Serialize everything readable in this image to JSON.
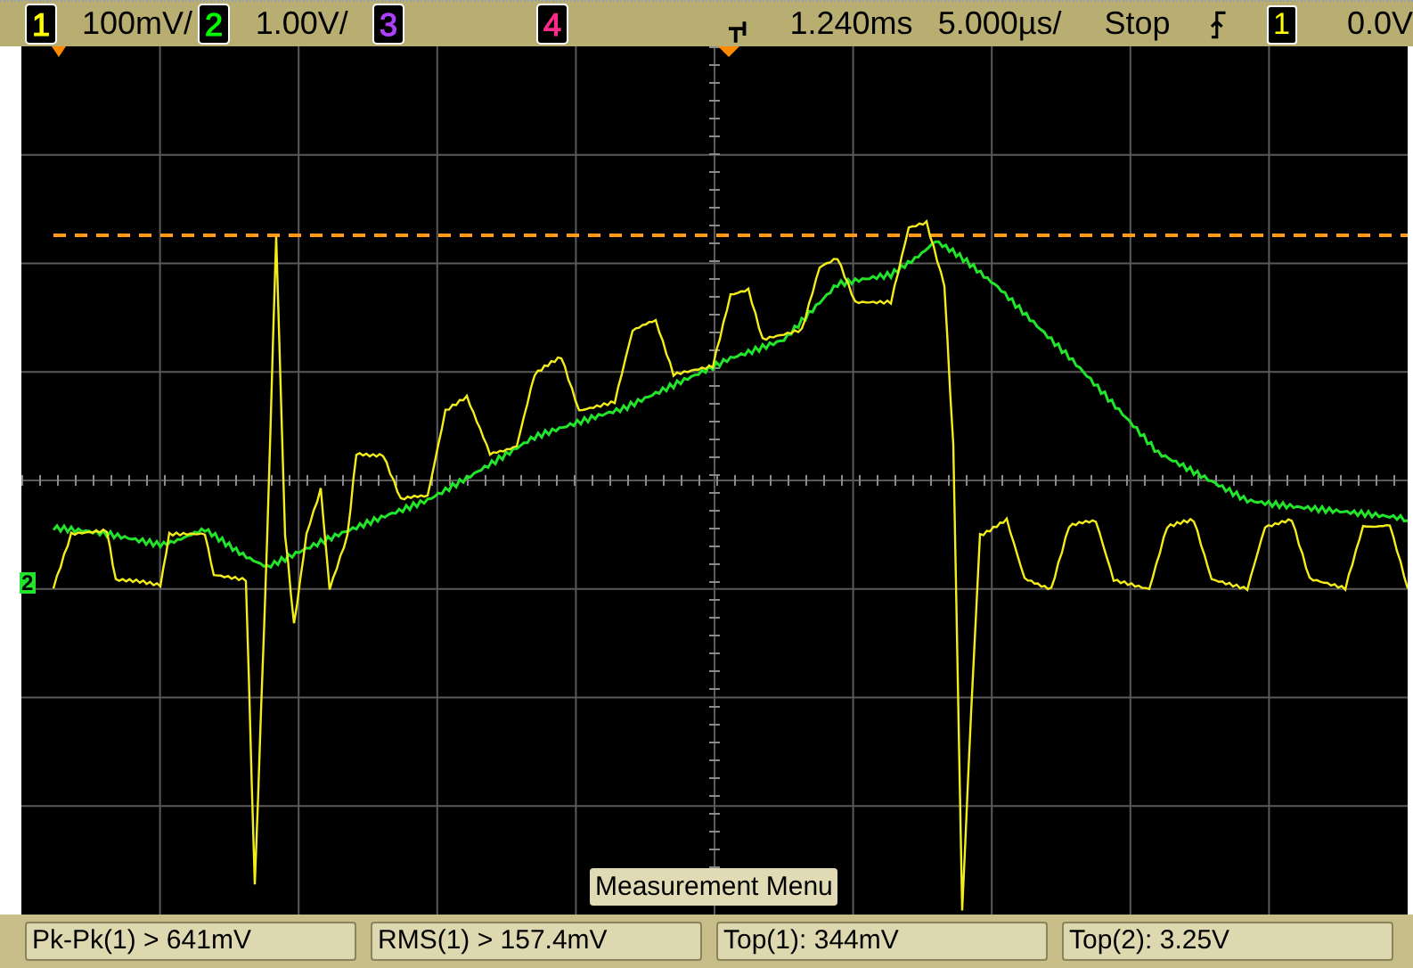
{
  "top_bar": {
    "channels": [
      {
        "number": "1",
        "scale": "100mV/",
        "color": "#ffff00"
      },
      {
        "number": "2",
        "scale": "1.00V/",
        "color": "#00ff00"
      },
      {
        "number": "3",
        "color": "#b040ff"
      },
      {
        "number": "4",
        "color": "#ff2a8a"
      }
    ],
    "delay": "1.240ms",
    "timebase": "5.000µs/",
    "run_state": "Stop",
    "trigger_source": "1",
    "trigger_level": "0.0V"
  },
  "display": {
    "ground_marker": "2",
    "menu_title": "Measurement Menu"
  },
  "measurements": [
    "Pk-Pk(1) > 641mV",
    "RMS(1) > 157.4mV",
    "Top(1): 344mV",
    "Top(2): 3.25V"
  ]
}
